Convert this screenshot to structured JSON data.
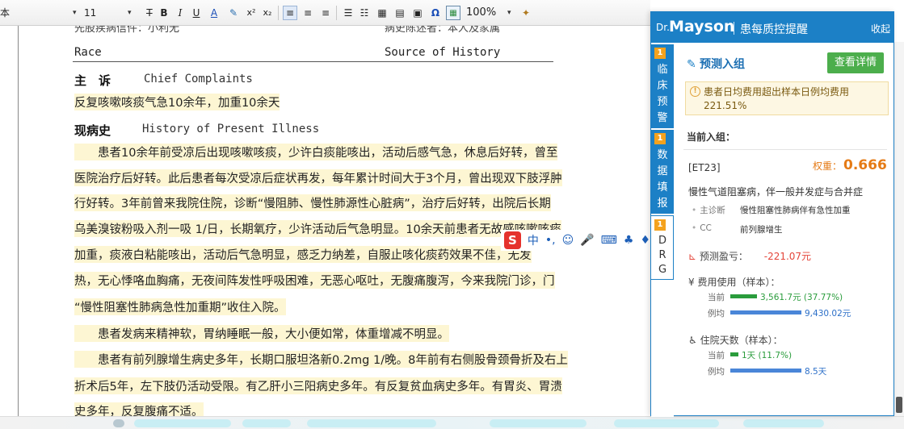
{
  "toolbar": {
    "font_name": "本",
    "font_size": "11",
    "zoom": "100%"
  },
  "document": {
    "header_cut_left": "先股疾病信件：小利无",
    "header_cut_right": "病史陈述者：本人及家属",
    "header_left_en": "Race",
    "header_right_en": "Source of History",
    "chief_title": "主　诉",
    "chief_en": "Chief Complaints",
    "chief_text": "反复咳嗽咳痰气急10余年，加重10余天",
    "hpi_title": "现病史",
    "hpi_en": "History of Present Illness",
    "lines": [
      "　　患者10余年前受凉后出现咳嗽咳痰，少许白痰能咳出，活动后感气急，休息后好转，曾至",
      "医院治疗后好转。此后患者每次受凉后症状再发，每年累计时间大于3个月，曾出现双下肢浮肿",
      "行好转。3年前曾来我院住院，诊断“慢阻肺、慢性肺源性心脏病”，治疗后好转，出院后长期",
      "乌美溴铵粉吸入剂一吸 1/日，长期氧疗，少许活动后气急明显。10余天前患者无故感咳嗽咳痰",
      "加重，痰液白粘能咳出，活动后气急明显，感乏力纳差，自服止咳化痰药效果不佳，无发",
      "热，无心悸咯血胸痛，无夜间阵发性呼吸困难，无恶心呕吐，无腹痛腹泻，今来我院门诊，门",
      "“慢性阻塞性肺病急性加重期”收住入院。",
      "　　患者发病来精神软，胃纳睡眠一般，大小便如常，体重增减不明显。",
      "　　患者有前列腺增生病史多年，长期口服坦洛新0.2mg 1/晚。8年前有右侧股骨颈骨折及右上",
      "折术后5年，左下肢仍活动受限。有乙肝小三阳病史多年。有反复贫血病史多年。有胃炎、胃溃",
      "史多年，反复腹痛不适。"
    ],
    "ime_label": "中"
  },
  "panel": {
    "brand_prefix": "Dr.",
    "brand_name": "Mayson",
    "brand_sub": "患每质控提醒",
    "collapse": "收起",
    "tabs": [
      {
        "num": "1",
        "label": "临床预警"
      },
      {
        "num": "1",
        "label": "数据填报"
      },
      {
        "num": "1",
        "label": "DRG"
      }
    ],
    "title": "预测入组",
    "detail_button": "查看详情",
    "warning": "患者日均费用超出样本日例均费用 221.51%",
    "current_group_label": "当前入组：",
    "code": "[ET23]",
    "weight_label": "权重：",
    "weight_value": "0.666",
    "drg_name": "慢性气道阻塞病，伴一般并发症与合并症",
    "main_dx_label": "主诊断",
    "main_dx_value": "慢性阻塞性肺病伴有急性加重",
    "cc_label": "CC",
    "cc_value": "前列腺增生",
    "profit_label": "预测盈亏：",
    "profit_value": "-221.07元",
    "cost_label": "费用使用（样本）：",
    "cost_current_label": "当前",
    "cost_current_value": "3,561.7元 (37.77%)",
    "cost_sample_label": "例均",
    "cost_sample_value": "9,430.02元",
    "cost_ratio": 0.3777,
    "days_label": "住院天数（样本）：",
    "days_current_label": "当前",
    "days_current_value": "1天 (11.7%)",
    "days_sample_label": "例均",
    "days_sample_value": "8.5天",
    "days_ratio": 0.117,
    "colors": {
      "accent": "#1c80c6",
      "button": "#4cae4c",
      "negative": "#e4453a",
      "weight": "#e57b16"
    }
  }
}
